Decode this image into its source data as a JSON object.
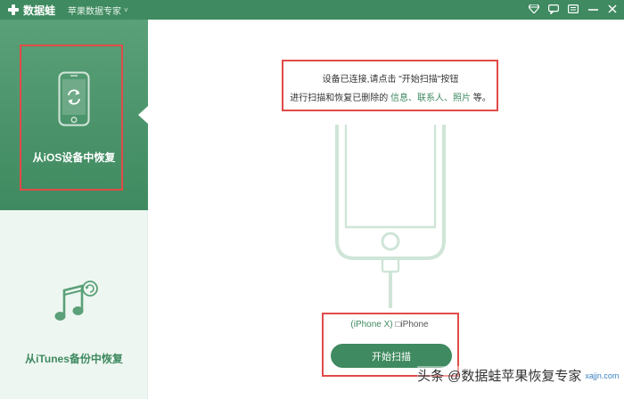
{
  "titlebar": {
    "app_name": "数据蛙",
    "subtitle": "苹果数据专家",
    "caret": "˅",
    "icons": [
      "diamond-icon",
      "comment-icon",
      "menu-icon",
      "minimize-icon",
      "close-icon"
    ]
  },
  "sidebar": {
    "items": [
      {
        "label": "从iOS设备中恢复",
        "icon": "phone-restore-icon",
        "active": true
      },
      {
        "label": "从iTunes备份中恢复",
        "icon": "music-restore-icon",
        "active": false
      }
    ]
  },
  "main": {
    "message": {
      "line1": "设备已连接,请点击 \"开始扫描\"按钮",
      "line2_prefix": "进行扫描和恢复已删除的",
      "line2_highlight": "信息、联系人、照片",
      "line2_suffix": "等。"
    },
    "device": {
      "model": "(iPhone X)",
      "name": "□iPhone"
    },
    "scan_button": "开始扫描"
  },
  "watermark": {
    "text": "头条 @数据蛙苹果恢复专家",
    "site": "xajjn.com"
  },
  "colors": {
    "accent": "#3f8a60",
    "highlight_box": "#e24b48",
    "sidebar_bg": "#eef6f1"
  }
}
